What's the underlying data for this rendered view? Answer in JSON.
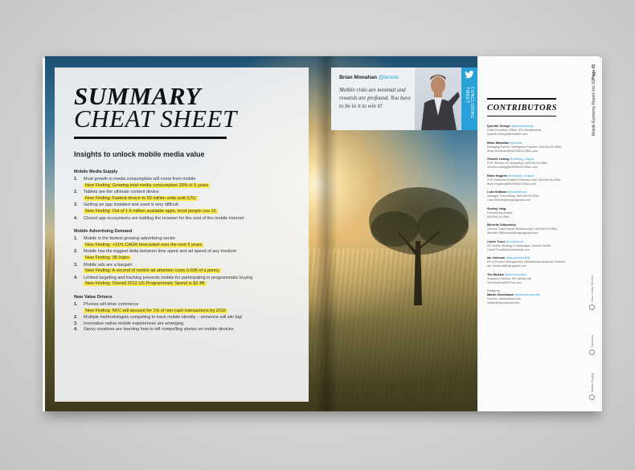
{
  "summary": {
    "title_line1": "SUMMARY",
    "title_line2": "CHEAT SHEET",
    "subtitle": "Insights to unlock mobile media value",
    "sections": [
      {
        "heading": "Mobile Media Supply",
        "items": [
          {
            "num": "1.",
            "text": "Most growth in media consumption will come from mobile",
            "finding": "New Finding: Growing total media consumption 20% in 5 years"
          },
          {
            "num": "2.",
            "text": "Tablets are the ultimate content device",
            "finding": "New Finding: Fastest device to 50 million units sold (US)"
          },
          {
            "num": "3.",
            "text": "Getting an app installed and used is very difficult",
            "finding": "New Finding: Out of 1.5 million available apps, most people use 15"
          },
          {
            "num": "4.",
            "text": "Closed app ecosystems are battling the browser for the soul of the mobile Internet",
            "finding": ""
          }
        ]
      },
      {
        "heading": "Mobile Advertising Demand",
        "items": [
          {
            "num": "1.",
            "text": "Mobile is the fastest growing advertising sector",
            "finding": "New Finding: +31% CAGR forecasted over the next 5 years"
          },
          {
            "num": "2.",
            "text": "Mobile has the biggest delta between time spent and ad spend of any medium",
            "finding": "New Finding: 38 Index"
          },
          {
            "num": "3.",
            "text": "Mobile ads are a bargain",
            "finding": "New Finding: A second of mobile ad attention costs 0.006 of a penny"
          },
          {
            "num": "4.",
            "text": "Limited targeting and tracking prevents mobile for participating in programmatic buying",
            "finding": "New Finding: Overall 2012 US Programmatic Spend is $2.4B"
          }
        ]
      },
      {
        "heading": "New Value Drivers",
        "items": [
          {
            "num": "1.",
            "text": "Phones will drive commerce",
            "finding": "New Finding: NFC will account for 1% of non-cash transactions by 2016"
          },
          {
            "num": "2.",
            "text": "Multiple methodologies competing to track mobile identity – someone will win big!",
            "finding": ""
          },
          {
            "num": "3.",
            "text": "Innovative native mobile experiences are emerging",
            "finding": ""
          },
          {
            "num": "4.",
            "text": "Savvy creatives are learning how to tell compelling stories on mobile devices",
            "finding": ""
          }
        ]
      }
    ]
  },
  "quote": {
    "name": "Brian Monahan",
    "handle": "@brionic",
    "text": "Mobile risks are minimal and rewards are profound. You have to be in it to win it!",
    "strip_label": "CONCLUDING TWEET"
  },
  "contributors": {
    "title": "CONTRIBUTORS",
    "header_title": "Mobile Economy Report Vol. 02",
    "header_page": "Page 43",
    "people": [
      {
        "name": "Quentin George",
        "handle": "@quentingeorge",
        "role": "Chief Innovation Officer, IPG Mediabrands",
        "email": "Quentin.George@initiative.com"
      },
      {
        "name": "Brian Monahan",
        "handle": "@brionic",
        "role": "Managing Partner, Intelligence Practice, MAGNA GLOBAL",
        "email": "Brian.Monahan@MAGNAGLOBAL.com"
      },
      {
        "name": "Vincent Letang",
        "handle": "@vletang_magna",
        "role": "EVP, Director of Forecasting, MAGNA GLOBAL",
        "email": "Vincent.Letang@MAGNAGLOBAL.com"
      },
      {
        "name": "Brian Hughes",
        "handle": "@bhughes_magna",
        "role": "SVP, Audience Analytics Practice Lead, MAGNA GLOBAL",
        "email": "Brian.Hughes@MAGNAGLOBAL.com"
      },
      {
        "name": "Luke Stillman",
        "handle": "@lukestillman",
        "role": "Manager, Forecasting, MAGNA GLOBAL",
        "email": "Luke.Stillman@magnaglobal.com"
      },
      {
        "name": "Shelley Yang",
        "handle": "",
        "role": "Forecasting Analyst",
        "email": "MAGNA GLOBAL"
      },
      {
        "name": "Michelle Stikovskey",
        "handle": "",
        "role": "Director, Data Partner Relationships, MAGNA GLOBAL",
        "email": "Michelle.Stikovskey@magnaglobal.com"
      },
      {
        "name": "Carter Trout",
        "handle": "@Cartertrout",
        "role": "VP, Mobile Strategy & Campaigns, Amobie Mobile",
        "email": "Carter.Trout@AmobieMobile.com"
      },
      {
        "name": "Ian Johnson",
        "handle": "@iancjohnsonMB",
        "role": "VP of Product Management, Mediabrands Audience Platform",
        "email": "Ian.Johnson@map-global.com"
      },
      {
        "name": "Tim McAtee",
        "handle": "@timmcmcatee",
        "role": "Research Director, IPG Media Lab",
        "email": "Tim.McAtee@IPGLab.com"
      }
    ],
    "design": {
      "label": "Design by",
      "name": "Martin Oberhäuser",
      "handle": "@oberhaeuserinfo",
      "role": "Founder, oberhaeuser.info",
      "email": "martin@oberhaeuser.info"
    },
    "nav": [
      "New Value Drivers",
      "Demand",
      "Media Supply"
    ]
  }
}
